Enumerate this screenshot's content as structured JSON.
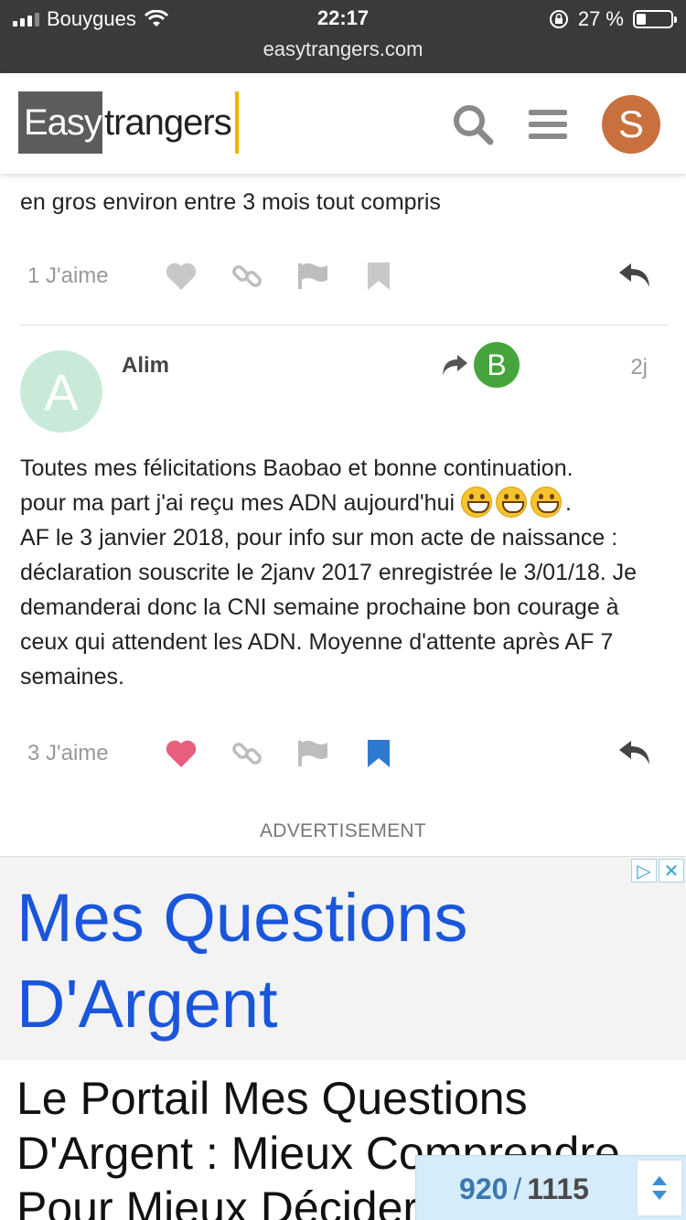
{
  "status_bar": {
    "carrier": "Bouygues",
    "time": "22:17",
    "battery_percent": "27 %",
    "battery_level": 0.27,
    "url": "easytrangers.com"
  },
  "header": {
    "logo_part1": "Easy",
    "logo_part2": "trangers",
    "user_initial": "S",
    "user_avatar_color": "#c8703e",
    "brand_accent": "#f0b400"
  },
  "post_prev": {
    "text": "en gros environ entre 3 mois tout compris",
    "likes_label": "1 J'aime",
    "liked": false,
    "bookmarked": false
  },
  "post": {
    "avatar_initial": "A",
    "author": "Alim",
    "reply_to_initial": "B",
    "age": "2j",
    "text_line1": "Toutes mes félicitations Baobao et bonne continuation.",
    "text_line2_start": "pour ma part j'ai reçu mes ADN aujourd'hui ",
    "text_line2_end": ".",
    "text_rest": "AF le 3 janvier 2018, pour info sur mon acte de naissance : déclaration souscrite le 2janv 2017 enregistrée le 3/01/18. Je demanderai donc la CNI semaine prochaine bon courage à ceux qui attendent les ADN. Moyenne d'attente après AF 7 semaines.",
    "likes_label": "3 J'aime",
    "liked": true,
    "bookmarked": true,
    "like_color": "#e85f7e",
    "bookmark_color": "#2f7ad1"
  },
  "advertisement": {
    "label": "ADVERTISEMENT",
    "title": "Mes Questions D'Argent",
    "subtitle": "Le Portail Mes Questions D'Argent : Mieux Comprendre Pour Mieux Décider",
    "choices_icon": "ad-choices-icon",
    "close_icon": "close-icon"
  },
  "topic_progress": {
    "current": "920",
    "separator": "/",
    "total": "1115"
  }
}
